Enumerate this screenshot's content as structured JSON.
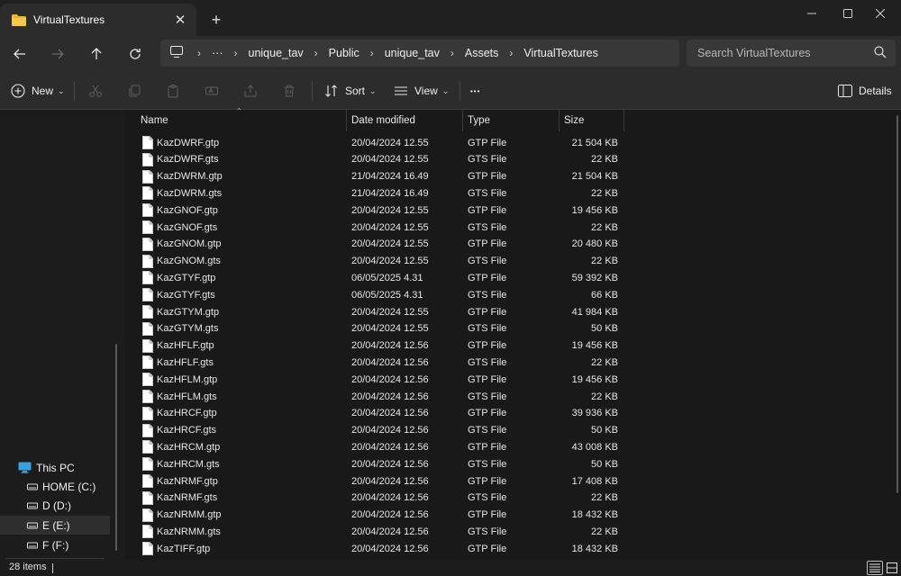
{
  "tab": {
    "title": "VirtualTextures",
    "close_icon": "close-icon",
    "new_tab": "+"
  },
  "colors": {
    "folder": "#e8b730",
    "bg": "#191919",
    "panel": "#2c2c2c",
    "drive_icon": "#dcdcdc",
    "pc_icon": "#3aa0e0"
  },
  "address": {
    "crumbs": [
      "unique_tav",
      "Public",
      "unique_tav",
      "Assets",
      "VirtualTextures"
    ],
    "overflow": "···"
  },
  "search": {
    "placeholder": "Search VirtualTextures"
  },
  "toolbar": {
    "new_label": "New",
    "sort_label": "Sort",
    "view_label": "View",
    "more_label": "•••",
    "details_label": "Details"
  },
  "columns": {
    "name": "Name",
    "date": "Date modified",
    "type": "Type",
    "size": "Size"
  },
  "files": [
    {
      "name": "KazDWRF.gtp",
      "date": "20/04/2024 12.55",
      "type": "GTP File",
      "size": "21 504 KB"
    },
    {
      "name": "KazDWRF.gts",
      "date": "20/04/2024 12.55",
      "type": "GTS File",
      "size": "22 KB"
    },
    {
      "name": "KazDWRM.gtp",
      "date": "21/04/2024 16.49",
      "type": "GTP File",
      "size": "21 504 KB"
    },
    {
      "name": "KazDWRM.gts",
      "date": "21/04/2024 16.49",
      "type": "GTS File",
      "size": "22 KB"
    },
    {
      "name": "KazGNOF.gtp",
      "date": "20/04/2024 12.55",
      "type": "GTP File",
      "size": "19 456 KB"
    },
    {
      "name": "KazGNOF.gts",
      "date": "20/04/2024 12.55",
      "type": "GTS File",
      "size": "22 KB"
    },
    {
      "name": "KazGNOM.gtp",
      "date": "20/04/2024 12.55",
      "type": "GTP File",
      "size": "20 480 KB"
    },
    {
      "name": "KazGNOM.gts",
      "date": "20/04/2024 12.55",
      "type": "GTS File",
      "size": "22 KB"
    },
    {
      "name": "KazGTYF.gtp",
      "date": "06/05/2025 4.31",
      "type": "GTP File",
      "size": "59 392 KB"
    },
    {
      "name": "KazGTYF.gts",
      "date": "06/05/2025 4.31",
      "type": "GTS File",
      "size": "66 KB"
    },
    {
      "name": "KazGTYM.gtp",
      "date": "20/04/2024 12.55",
      "type": "GTP File",
      "size": "41 984 KB"
    },
    {
      "name": "KazGTYM.gts",
      "date": "20/04/2024 12.55",
      "type": "GTS File",
      "size": "50 KB"
    },
    {
      "name": "KazHFLF.gtp",
      "date": "20/04/2024 12.56",
      "type": "GTP File",
      "size": "19 456 KB"
    },
    {
      "name": "KazHFLF.gts",
      "date": "20/04/2024 12.56",
      "type": "GTS File",
      "size": "22 KB"
    },
    {
      "name": "KazHFLM.gtp",
      "date": "20/04/2024 12.56",
      "type": "GTP File",
      "size": "19 456 KB"
    },
    {
      "name": "KazHFLM.gts",
      "date": "20/04/2024 12.56",
      "type": "GTS File",
      "size": "22 KB"
    },
    {
      "name": "KazHRCF.gtp",
      "date": "20/04/2024 12.56",
      "type": "GTP File",
      "size": "39 936 KB"
    },
    {
      "name": "KazHRCF.gts",
      "date": "20/04/2024 12.56",
      "type": "GTS File",
      "size": "50 KB"
    },
    {
      "name": "KazHRCM.gtp",
      "date": "20/04/2024 12.56",
      "type": "GTP File",
      "size": "43 008 KB"
    },
    {
      "name": "KazHRCM.gts",
      "date": "20/04/2024 12.56",
      "type": "GTS File",
      "size": "50 KB"
    },
    {
      "name": "KazNRMF.gtp",
      "date": "20/04/2024 12.56",
      "type": "GTP File",
      "size": "17 408 KB"
    },
    {
      "name": "KazNRMF.gts",
      "date": "20/04/2024 12.56",
      "type": "GTS File",
      "size": "22 KB"
    },
    {
      "name": "KazNRMM.gtp",
      "date": "20/04/2024 12.56",
      "type": "GTP File",
      "size": "18 432 KB"
    },
    {
      "name": "KazNRMM.gts",
      "date": "20/04/2024 12.56",
      "type": "GTS File",
      "size": "22 KB"
    },
    {
      "name": "KazTIFF.gtp",
      "date": "20/04/2024 12.56",
      "type": "GTP File",
      "size": "18 432 KB"
    }
  ],
  "sidebar": {
    "items": [
      {
        "label": "This PC",
        "icon": "pc-icon"
      },
      {
        "label": "HOME (C:)",
        "icon": "drive-icon"
      },
      {
        "label": "D (D:)",
        "icon": "drive-icon"
      },
      {
        "label": "E (E:)",
        "icon": "drive-icon",
        "selected": true
      },
      {
        "label": "F (F:)",
        "icon": "drive-icon"
      }
    ]
  },
  "status": {
    "item_count": "28 items"
  }
}
